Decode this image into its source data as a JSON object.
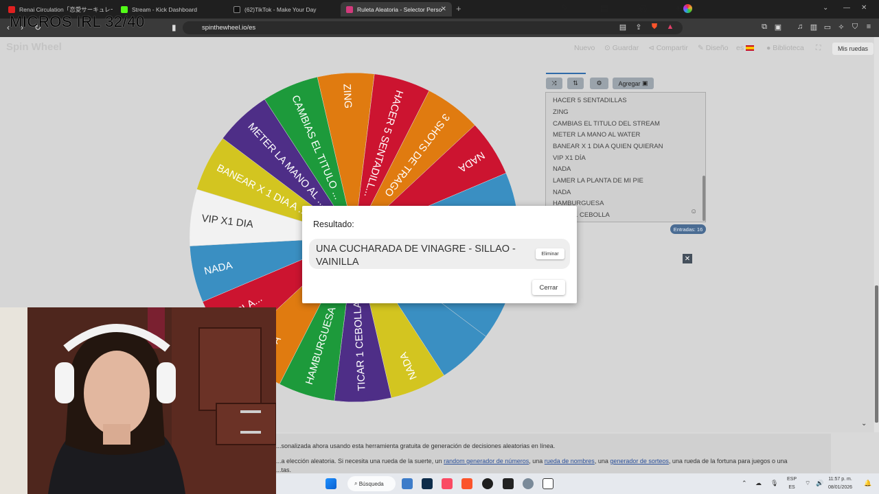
{
  "overlay_text": "MICROS IRL 32/40",
  "browser": {
    "tabs": [
      {
        "title": "Renai Circulation「恋愛サーキュレーショ",
        "color": "#e02020"
      },
      {
        "title": "Stream - Kick Dashboard",
        "color": "#53fc18"
      },
      {
        "title": "(62)TikTok - Make Your Day",
        "color": "#111111"
      },
      {
        "title": "Ruleta Aleatoria - Selector Perso",
        "color": "#d33a7c"
      }
    ],
    "url": "spinthewheel.io/es"
  },
  "site": {
    "logo": "Spin Wheel",
    "nav": {
      "new": "Nuevo",
      "save": "Guardar",
      "share": "Compartir",
      "design": "Diseño",
      "lang": "es",
      "library": "Biblioteca",
      "my_wheels": "Mis ruedas"
    }
  },
  "wheel": {
    "segments": [
      {
        "label": "ZING",
        "color": "#e07b10"
      },
      {
        "label": "HACER 5 SENTADILL...",
        "color": "#cc1430"
      },
      {
        "label": "3 SHOTS DE TRAGO",
        "color": "#e07b10"
      },
      {
        "label": "NADA",
        "color": "#cc1430"
      },
      {
        "label": "",
        "color": "#3a8fc2"
      },
      {
        "label": "",
        "color": "#3a8fc2"
      },
      {
        "label": "",
        "color": "#3a8fc2"
      },
      {
        "label": "",
        "color": "#3a8fc2"
      },
      {
        "label": "NADA",
        "color": "#d3c520"
      },
      {
        "label": "TICAR 1 CEBOLLA",
        "color": "#4e2e87"
      },
      {
        "label": "HAMBURGUESA",
        "color": "#1d9a3b"
      },
      {
        "label": "NADA",
        "color": "#e07b10"
      },
      {
        "label": "LA PLA...",
        "color": "#cc1430"
      },
      {
        "label": "NADA",
        "color": "#3a8fc2"
      },
      {
        "label": "VIP X1 DIA",
        "color": "#f2f2f2"
      },
      {
        "label": "BANEAR X 1 DIA A ...",
        "color": "#d3c520"
      },
      {
        "label": "METER LA MANO AL ...",
        "color": "#4e2e87"
      },
      {
        "label": "CAMBIAS EL TITULO ...",
        "color": "#1d9a3b"
      }
    ]
  },
  "editor": {
    "add_label": "Agregar",
    "entries": [
      "HACER 5 SENTADILLAS",
      "ZING",
      "CAMBIAS EL TITULO DEL STREAM",
      "METER LA MANO AL WATER",
      "BANEAR X 1 DIA A QUIEN QUIERAN",
      "VIP X1 DÍA",
      "NADA",
      "LAMER LA PLANTA DE MI PIE",
      "NADA",
      "HAMBURGUESA",
      "TICAR 1 CEBOLLA"
    ],
    "entries_count": "Entradas: 16"
  },
  "modal": {
    "title": "Resultado:",
    "result": "UNA CUCHARADA DE VINAGRE - SILLAO - VAINILLA",
    "remove": "Eliminar",
    "close": "Cerrar"
  },
  "description": {
    "line1": "...sonalizada ahora usando esta herramienta gratuita de generación de decisiones aleatorias en línea.",
    "line2_a": "...a elección aleatoria. Si necesita una rueda de la suerte, un ",
    "link1": "random generador de números",
    "line2_b": ", una ",
    "link2": "rueda de nombres",
    "line2_c": ", una ",
    "link3": "generador de sorteos",
    "line2_d": ", una rueda de la fortuna para juegos o una",
    "line3": "...tas."
  },
  "taskbar": {
    "search": "Búsqueda",
    "lang_top": "ESP",
    "lang_bottom": "ES",
    "time": "11:57 p. m.",
    "date": "08/01/2026"
  }
}
